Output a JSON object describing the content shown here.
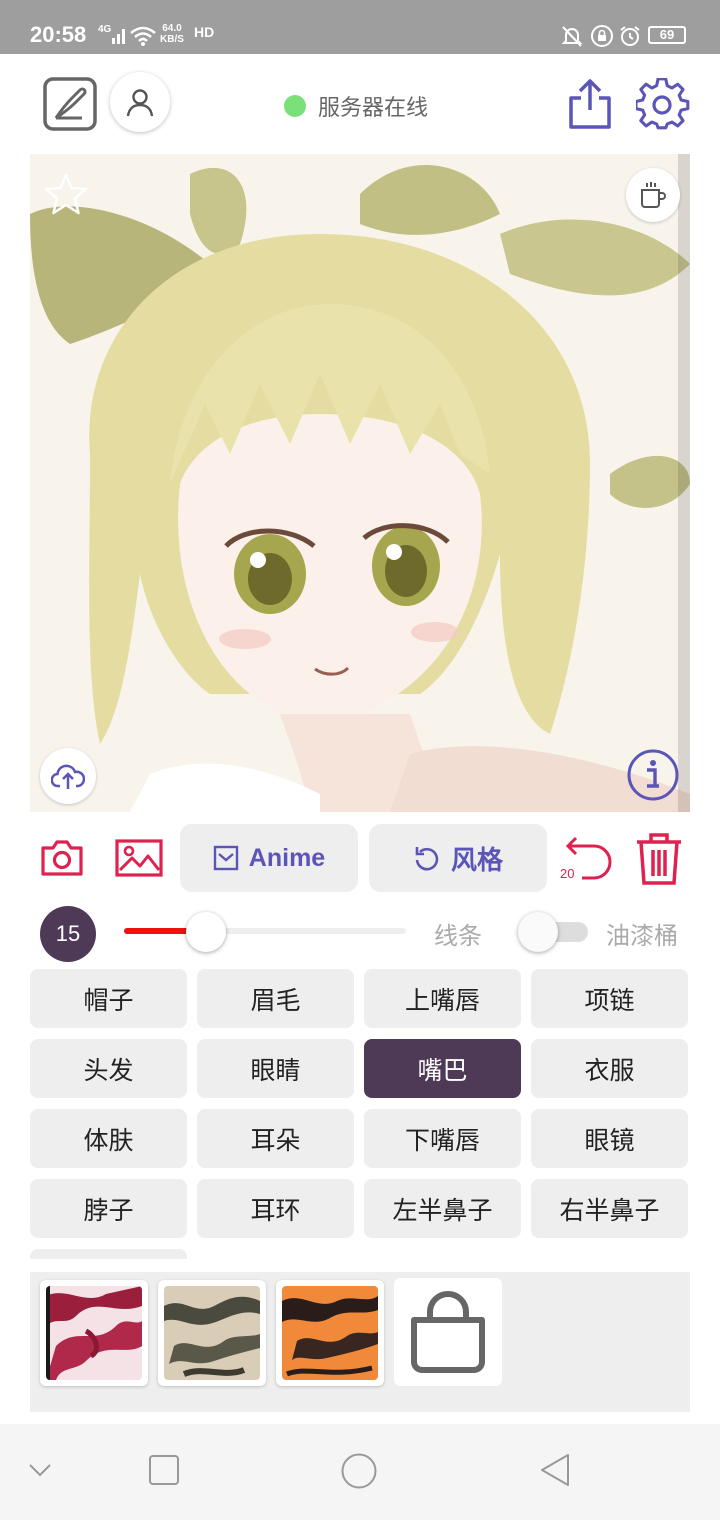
{
  "status_bar": {
    "time": "20:58",
    "network": "4G",
    "speed_value": "64.0",
    "speed_unit": "KB/S",
    "hd": "HD",
    "battery": "69"
  },
  "header": {
    "server_status": "服务器在线",
    "server_status_color": "#7ce07a"
  },
  "actions": {
    "anime_label": "Anime",
    "style_label": "风格",
    "undo_count": "20",
    "accent_color": "#5b55b8",
    "danger_color": "#e0204e"
  },
  "brush": {
    "size": "15",
    "slider_fraction": 0.29,
    "line_label": "线条",
    "bucket_label": "油漆桶",
    "bucket_enabled": false
  },
  "parts": [
    {
      "label": "帽子",
      "selected": false
    },
    {
      "label": "眉毛",
      "selected": false
    },
    {
      "label": "上嘴唇",
      "selected": false
    },
    {
      "label": "项链",
      "selected": false
    },
    {
      "label": "头发",
      "selected": false
    },
    {
      "label": "眼睛",
      "selected": false
    },
    {
      "label": "嘴巴",
      "selected": true
    },
    {
      "label": "衣服",
      "selected": false
    },
    {
      "label": "体肤",
      "selected": false
    },
    {
      "label": "耳朵",
      "selected": false
    },
    {
      "label": "下嘴唇",
      "selected": false
    },
    {
      "label": "眼镜",
      "selected": false
    },
    {
      "label": "脖子",
      "selected": false
    },
    {
      "label": "耳环",
      "selected": false
    },
    {
      "label": "左半鼻子",
      "selected": false
    },
    {
      "label": "右半鼻子",
      "selected": false
    }
  ],
  "selected_color": "#4e3a57",
  "swatches": [
    {
      "name": "red-white-texture",
      "colors": [
        "#f4e2e6",
        "#9b1e3c"
      ]
    },
    {
      "name": "gray-beige-texture",
      "colors": [
        "#d9cdb8",
        "#4a4a3e"
      ]
    },
    {
      "name": "orange-black-texture",
      "colors": [
        "#f08a3a",
        "#2a1c18"
      ]
    }
  ]
}
